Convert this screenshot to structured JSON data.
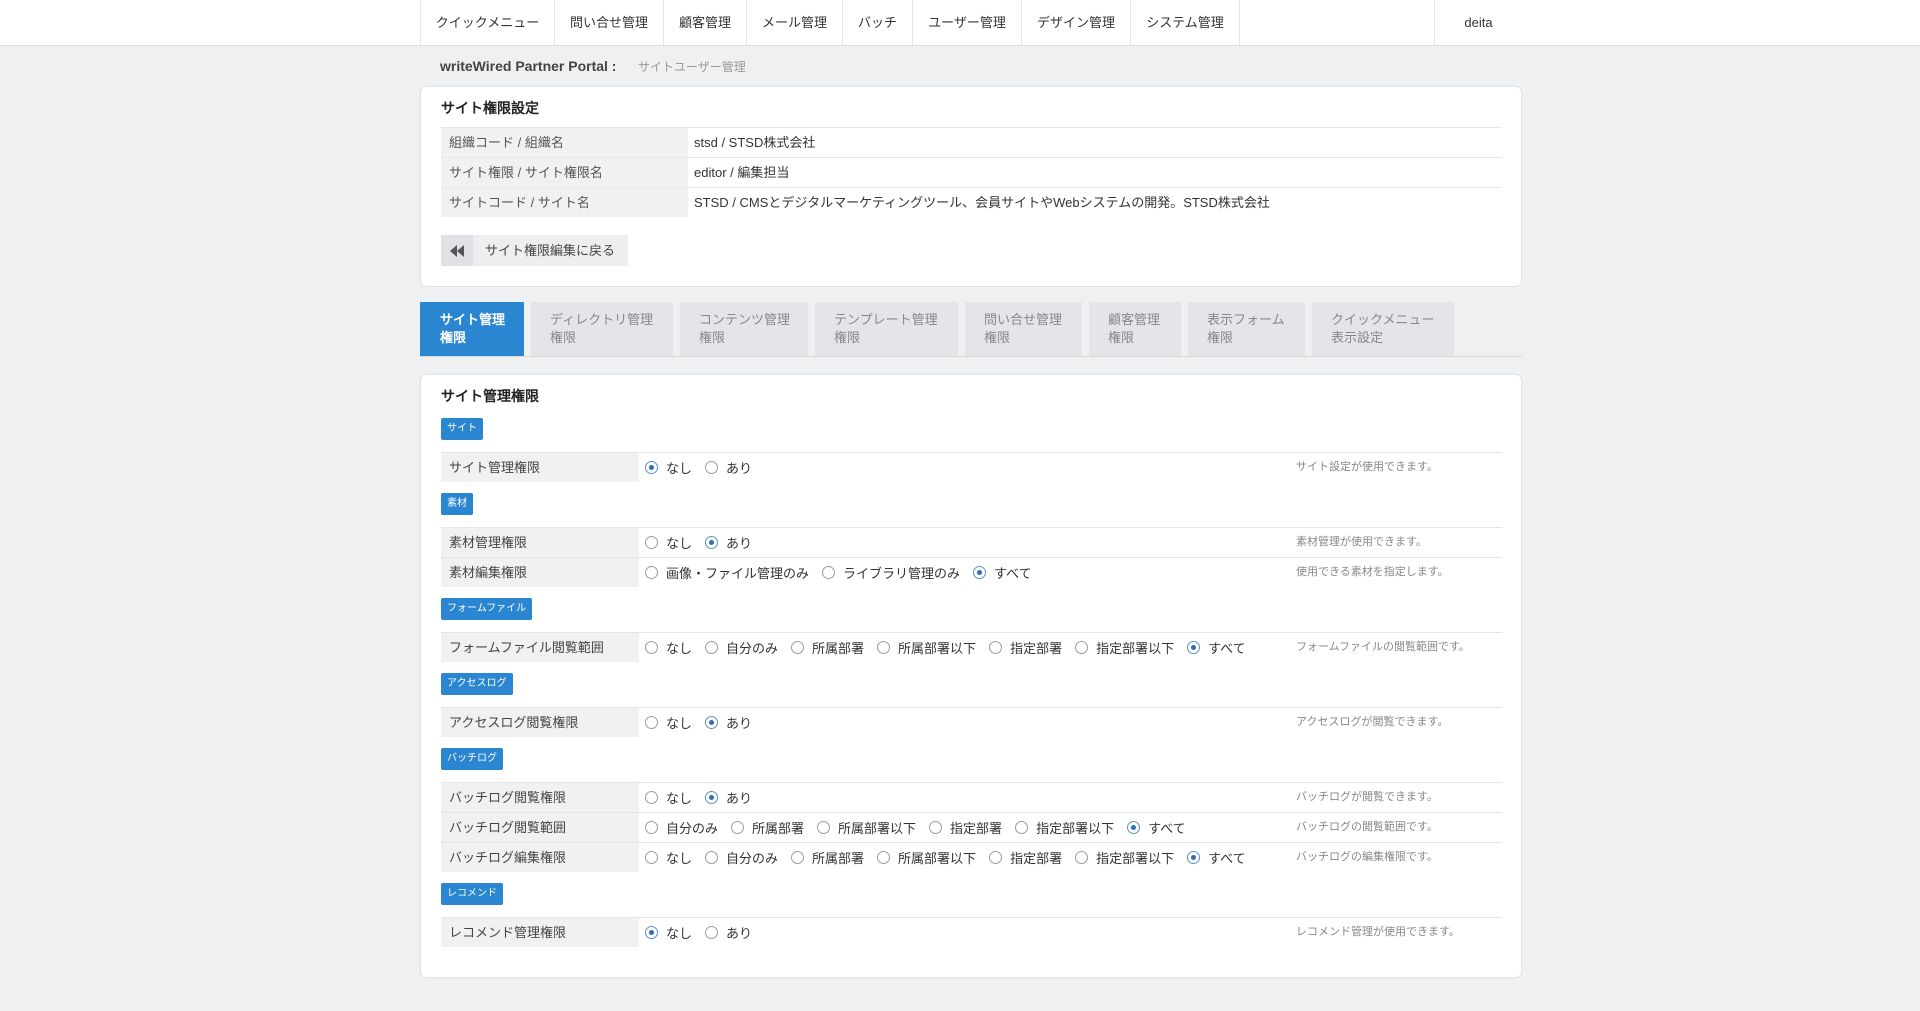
{
  "header": {
    "nav": [
      "クイックメニュー",
      "問い合せ管理",
      "顧客管理",
      "メール管理",
      "バッチ",
      "ユーザー管理",
      "デザイン管理",
      "システム管理"
    ],
    "user": "deita"
  },
  "breadcrumb": {
    "portal": "writeWired Partner Portal :",
    "page": "サイトユーザー管理"
  },
  "site_info": {
    "title": "サイト権限設定",
    "rows": [
      {
        "label": "組織コード / 組織名",
        "value": "stsd / STSD株式会社"
      },
      {
        "label": "サイト権限 / サイト権限名",
        "value": "editor / 編集担当"
      },
      {
        "label": "サイトコード / サイト名",
        "value": "STSD / CMSとデジタルマーケティングツール、会員サイトやWebシステムの開発。STSD株式会社"
      }
    ],
    "back_button": {
      "label": "サイト権限編集に戻る",
      "icon": "backward-icon"
    }
  },
  "tabs": [
    {
      "line1": "サイト管理",
      "line2": "権限",
      "active": true
    },
    {
      "line1": "ディレクトリ管理",
      "line2": "権限",
      "active": false
    },
    {
      "line1": "コンテンツ管理",
      "line2": "権限",
      "active": false
    },
    {
      "line1": "テンプレート管理",
      "line2": "権限",
      "active": false
    },
    {
      "line1": "問い合せ管理",
      "line2": "権限",
      "active": false
    },
    {
      "line1": "顧客管理",
      "line2": "権限",
      "active": false
    },
    {
      "line1": "表示フォーム",
      "line2": "権限",
      "active": false
    },
    {
      "line1": "クイックメニュー",
      "line2": "表示設定",
      "active": false
    }
  ],
  "panel": {
    "title": "サイト管理権限",
    "sections": [
      {
        "badge": "サイト",
        "rows": [
          {
            "label": "サイト管理権限",
            "options": [
              "なし",
              "あり"
            ],
            "selected": "なし",
            "help": "サイト設定が使用できます。"
          }
        ]
      },
      {
        "badge": "素材",
        "rows": [
          {
            "label": "素材管理権限",
            "options": [
              "なし",
              "あり"
            ],
            "selected": "あり",
            "help": "素材管理が使用できます。"
          },
          {
            "label": "素材編集権限",
            "options": [
              "画像・ファイル管理のみ",
              "ライブラリ管理のみ",
              "すべて"
            ],
            "selected": "すべて",
            "help": "使用できる素材を指定します。"
          }
        ]
      },
      {
        "badge": "フォームファイル",
        "rows": [
          {
            "label": "フォームファイル閲覧範囲",
            "options": [
              "なし",
              "自分のみ",
              "所属部署",
              "所属部署以下",
              "指定部署",
              "指定部署以下",
              "すべて"
            ],
            "selected": "すべて",
            "help": "フォームファイルの閲覧範囲です。"
          }
        ]
      },
      {
        "badge": "アクセスログ",
        "rows": [
          {
            "label": "アクセスログ閲覧権限",
            "options": [
              "なし",
              "あり"
            ],
            "selected": "あり",
            "help": "アクセスログが閲覧できます。"
          }
        ]
      },
      {
        "badge": "バッチログ",
        "rows": [
          {
            "label": "バッチログ閲覧権限",
            "options": [
              "なし",
              "あり"
            ],
            "selected": "あり",
            "help": "バッチログが閲覧できます。"
          },
          {
            "label": "バッチログ閲覧範囲",
            "options": [
              "自分のみ",
              "所属部署",
              "所属部署以下",
              "指定部署",
              "指定部署以下",
              "すべて"
            ],
            "selected": "すべて",
            "help": "バッチログの閲覧範囲です。"
          },
          {
            "label": "バッチログ編集権限",
            "options": [
              "なし",
              "自分のみ",
              "所属部署",
              "所属部署以下",
              "指定部署",
              "指定部署以下",
              "すべて"
            ],
            "selected": "すべて",
            "help": "バッチログの編集権限です。"
          }
        ]
      },
      {
        "badge": "レコメンド",
        "rows": [
          {
            "label": "レコメンド管理権限",
            "options": [
              "なし",
              "あり"
            ],
            "selected": "なし",
            "help": "レコメンド管理が使用できます。"
          }
        ]
      }
    ]
  },
  "colors": {
    "accent": "#2a86d1",
    "radio_dot": "#2c6fb5",
    "page_background": "#eff0f2"
  }
}
